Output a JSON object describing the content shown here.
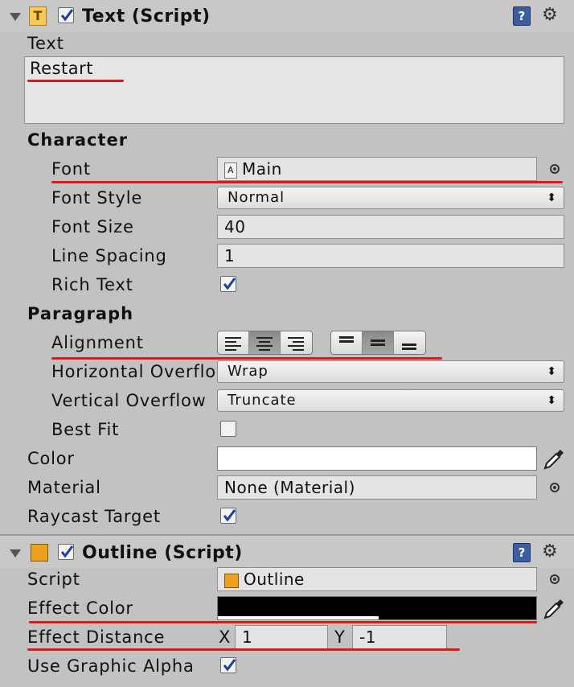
{
  "text_component": {
    "title": "Text (Script)",
    "enabled": true,
    "text_label": "Text",
    "text_value": "Restart",
    "character_heading": "Character",
    "font": {
      "label": "Font",
      "value": "Main"
    },
    "font_style": {
      "label": "Font Style",
      "value": "Normal"
    },
    "font_size": {
      "label": "Font Size",
      "value": "40"
    },
    "line_spacing": {
      "label": "Line Spacing",
      "value": "1"
    },
    "rich_text": {
      "label": "Rich Text",
      "checked": true
    },
    "paragraph_heading": "Paragraph",
    "alignment": {
      "label": "Alignment",
      "horizontal_selected": "center",
      "vertical_selected": "middle"
    },
    "horizontal_overflow": {
      "label": "Horizontal Overflo",
      "value": "Wrap"
    },
    "vertical_overflow": {
      "label": "Vertical Overflow",
      "value": "Truncate"
    },
    "best_fit": {
      "label": "Best Fit",
      "checked": false
    },
    "color": {
      "label": "Color",
      "value": "#ffffff"
    },
    "material": {
      "label": "Material",
      "value": "None (Material)"
    },
    "raycast_target": {
      "label": "Raycast Target",
      "checked": true
    }
  },
  "outline_component": {
    "title": "Outline (Script)",
    "enabled": true,
    "script": {
      "label": "Script",
      "value": "Outline"
    },
    "effect_color": {
      "label": "Effect Color",
      "value": "#000000"
    },
    "effect_distance": {
      "label": "Effect Distance",
      "x_label": "X",
      "x": "1",
      "y_label": "Y",
      "y": "-1"
    },
    "use_graphic_alpha": {
      "label": "Use Graphic Alpha",
      "checked": true
    }
  },
  "colors": {
    "annotation_red": "#e01818",
    "panel_bg": "#c2c2c2",
    "help_icon": "#3b5f9e",
    "component_icon": "#f0a020"
  }
}
